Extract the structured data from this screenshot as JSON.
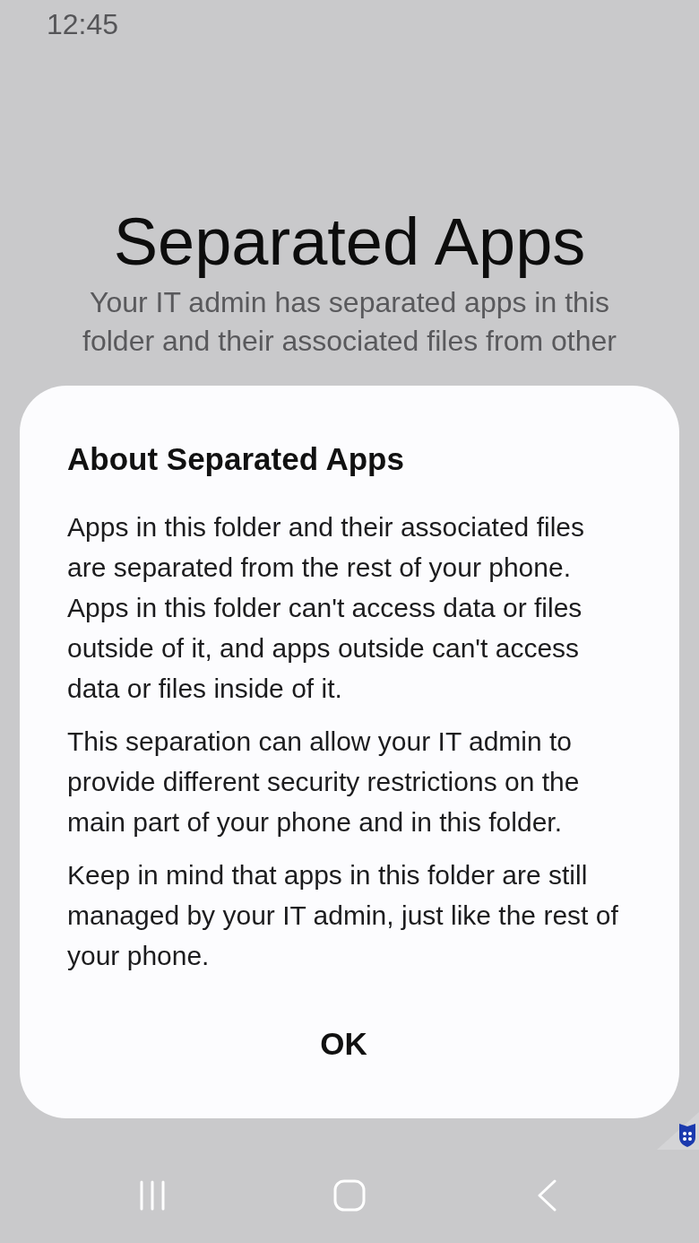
{
  "status_bar": {
    "time": "12:45"
  },
  "background": {
    "title": "Separated Apps",
    "description": "Your IT admin has separated apps in this folder and their associated files from other"
  },
  "dialog": {
    "title": "About Separated Apps",
    "paragraphs": [
      "Apps in this folder and their associated files are separated from the rest of your phone. Apps in this folder can't access data or files outside of it, and apps outside can't access data or files inside of it.",
      "This separation can allow your IT admin to provide different security restrictions on the main part of your phone and in this folder.",
      "Keep in mind that apps in this folder are still managed by your IT admin, just like the rest of your phone."
    ],
    "buttons": [
      "OK"
    ]
  }
}
